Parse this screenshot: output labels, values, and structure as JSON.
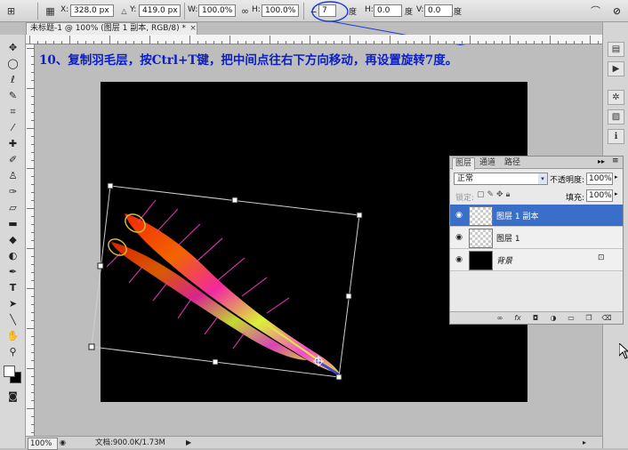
{
  "options_bar": {
    "x_label": "X:",
    "x_value": "328.0 px",
    "y_label": "Y:",
    "y_value": "419.0 px",
    "w_label": "W:",
    "w_value": "100.0%",
    "h_label": "H:",
    "h_value": "100.0%",
    "rotate_value": "7",
    "rotate_unit": "度",
    "hskew_label": "H:",
    "hskew_value": "0.0",
    "hskew_unit": "度",
    "vskew_label": "V:",
    "vskew_value": "0.0",
    "vskew_unit": "度"
  },
  "document_tab": {
    "title": "未标题-1 @ 100% (图层 1 副本, RGB/8) *",
    "close_glyph": "×"
  },
  "instruction_text": "10、复制羽毛层，按Ctrl+T键，把中间点往右下方向移动，再设置旋转7度。",
  "layers_panel": {
    "tabs": [
      "图层",
      "通道",
      "路径"
    ],
    "blend_mode": "正常",
    "opacity_label": "不透明度:",
    "opacity_value": "100%",
    "lock_label": "锁定:",
    "fill_label": "填充:",
    "fill_value": "100%",
    "layers": [
      {
        "name": "图层 1 副本",
        "selected": true
      },
      {
        "name": "图层 1",
        "selected": false
      },
      {
        "name": "背景",
        "selected": false
      }
    ]
  },
  "status_bar": {
    "zoom": "100%",
    "doc_info": "文档:900.0K/1.73M"
  },
  "colors": {
    "instruction": "#0a1ec8",
    "selection": "#3a6fc9",
    "canvas": "#000000"
  }
}
